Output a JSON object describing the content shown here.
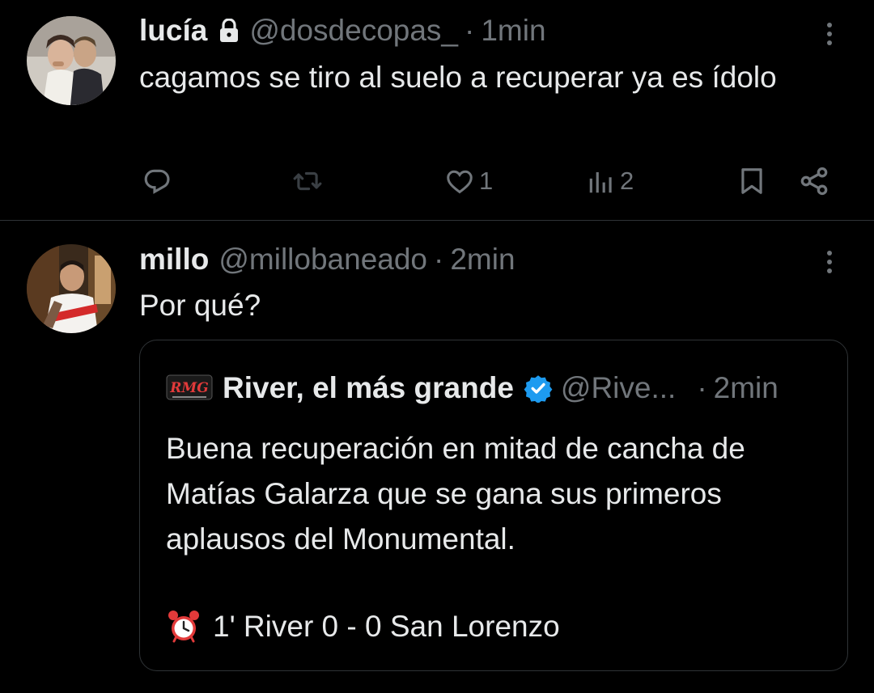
{
  "tweets": [
    {
      "author": {
        "name": "lucía",
        "handle": "@dosdecopas_",
        "protected": true,
        "avatar_icon": "avatar-photo-couple"
      },
      "separator": "·",
      "time": "1min",
      "text": "cagamos se tiro al suelo a recuperar ya es ídolo",
      "actions": {
        "reply": {
          "icon": "reply-icon",
          "count": ""
        },
        "retweet": {
          "icon": "retweet-icon",
          "count": ""
        },
        "like": {
          "icon": "heart-icon",
          "count": "1"
        },
        "views": {
          "icon": "views-icon",
          "count": "2"
        },
        "bookmark": {
          "icon": "bookmark-icon"
        },
        "share": {
          "icon": "share-icon"
        }
      }
    },
    {
      "author": {
        "name": "millo",
        "handle": "@millobaneado",
        "avatar_icon": "avatar-photo-player"
      },
      "separator": "·",
      "time": "2min",
      "text": "Por qué?",
      "quote": {
        "logo_text": "RMG",
        "name": "River, el más grande",
        "verified": true,
        "handle": "@Rive...",
        "separator": "·",
        "time": "2min",
        "text": "Buena recuperación en mitad de cancha de Matías Galarza que se gana sus primeros aplausos del Monumental.",
        "score": "1' River 0 - 0 San Lorenzo",
        "score_icon": "alarm-clock-icon"
      }
    }
  ],
  "colors": {
    "background": "#000000",
    "text_primary": "#e7e9ea",
    "text_secondary": "#71767b",
    "divider": "#2f3336",
    "verified_blue": "#1d9bf0"
  }
}
